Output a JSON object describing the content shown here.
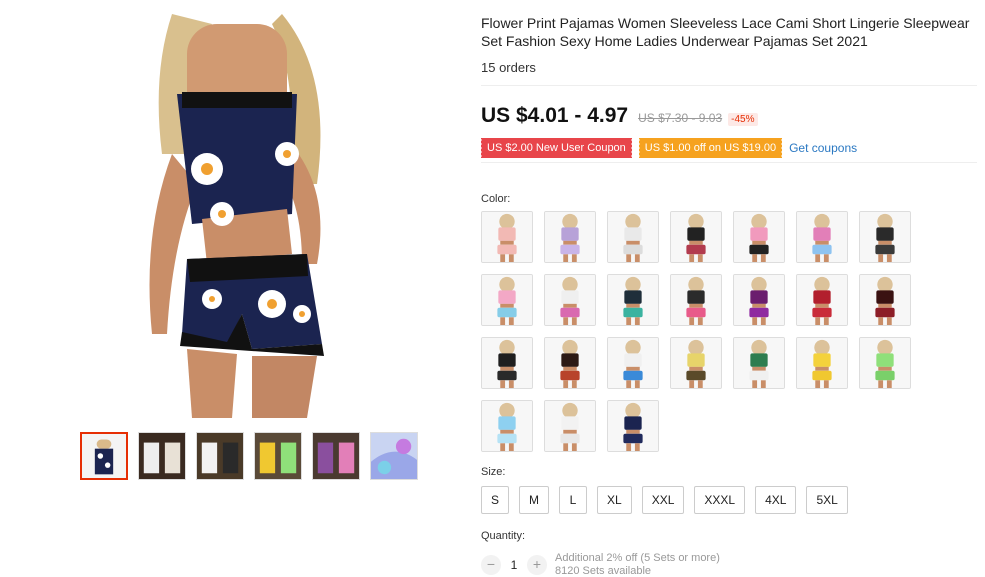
{
  "product": {
    "title": "Flower Print Pajamas Women Sleeveless Lace Cami Short Lingerie Sleepwear Set Fashion Sexy Home Ladies Underwear Pajamas Set 2021",
    "orders": "15 orders",
    "price": "US $4.01 - 4.97",
    "old_price": "US $7.30 - 9.03",
    "discount": "-45%"
  },
  "coupons": {
    "new_user": "US $2.00 New User Coupon",
    "store": "US $1.00 off on US $19.00",
    "get_link": "Get coupons"
  },
  "color": {
    "label": "Color:",
    "swatches": [
      {
        "top": "#f2b9b4",
        "bottom": "#f2b9b4"
      },
      {
        "top": "#b7a2d8",
        "bottom": "#c9b4e8"
      },
      {
        "top": "#e9e9e9",
        "bottom": "#dcdcdc"
      },
      {
        "top": "#222222",
        "bottom": "#b23b4e"
      },
      {
        "top": "#f19abd",
        "bottom": "#222222"
      },
      {
        "top": "#e27fb8",
        "bottom": "#8ec3f0"
      },
      {
        "top": "#2a2a2a",
        "bottom": "#3a3a3a"
      },
      {
        "top": "#f3a8c6",
        "bottom": "#86cde8"
      },
      {
        "top": "#efefef",
        "bottom": "#d96ab0"
      },
      {
        "top": "#1f2e3a",
        "bottom": "#3bb3a0"
      },
      {
        "top": "#2b2b2b",
        "bottom": "#e85b8a"
      },
      {
        "top": "#6b1e6e",
        "bottom": "#8f2aa0"
      },
      {
        "top": "#b21f2d",
        "bottom": "#c92c3a"
      },
      {
        "top": "#3a1212",
        "bottom": "#8c1e28"
      },
      {
        "top": "#1f1f1f",
        "bottom": "#2a2a2a"
      },
      {
        "top": "#2c1a15",
        "bottom": "#b8432b"
      },
      {
        "top": "#f0f0f0",
        "bottom": "#3a8ad8"
      },
      {
        "top": "#e7d46a",
        "bottom": "#5a4a2a"
      },
      {
        "top": "#2e7d4f",
        "bottom": "#f0f0f0"
      },
      {
        "top": "#f4d23c",
        "bottom": "#f0c830"
      },
      {
        "top": "#8fe07a",
        "bottom": "#7ad06a"
      },
      {
        "top": "#8ed0f0",
        "bottom": "#b5e2f5"
      },
      {
        "top": "#f2f2f2",
        "bottom": "#e8e8e8"
      },
      {
        "top": "#1b2450",
        "bottom": "#202a5c"
      }
    ]
  },
  "size": {
    "label": "Size:",
    "options": [
      "S",
      "M",
      "L",
      "XL",
      "XXL",
      "XXXL",
      "4XL",
      "5XL"
    ]
  },
  "quantity": {
    "label": "Quantity:",
    "value": "1",
    "minus": "−",
    "plus": "+",
    "note_line1": "Additional 2% off (5 Sets or more)",
    "note_line2": "8120 Sets available"
  },
  "gallery": {
    "thumb_colors": [
      "#1b2450",
      "#3a2a20",
      "#4a3a28",
      "#f0c830",
      "#8a4f9e",
      "#9aa7e8"
    ]
  },
  "icons": {
    "main_image": "product-photo",
    "thumbnail": "thumbnail-photo"
  }
}
